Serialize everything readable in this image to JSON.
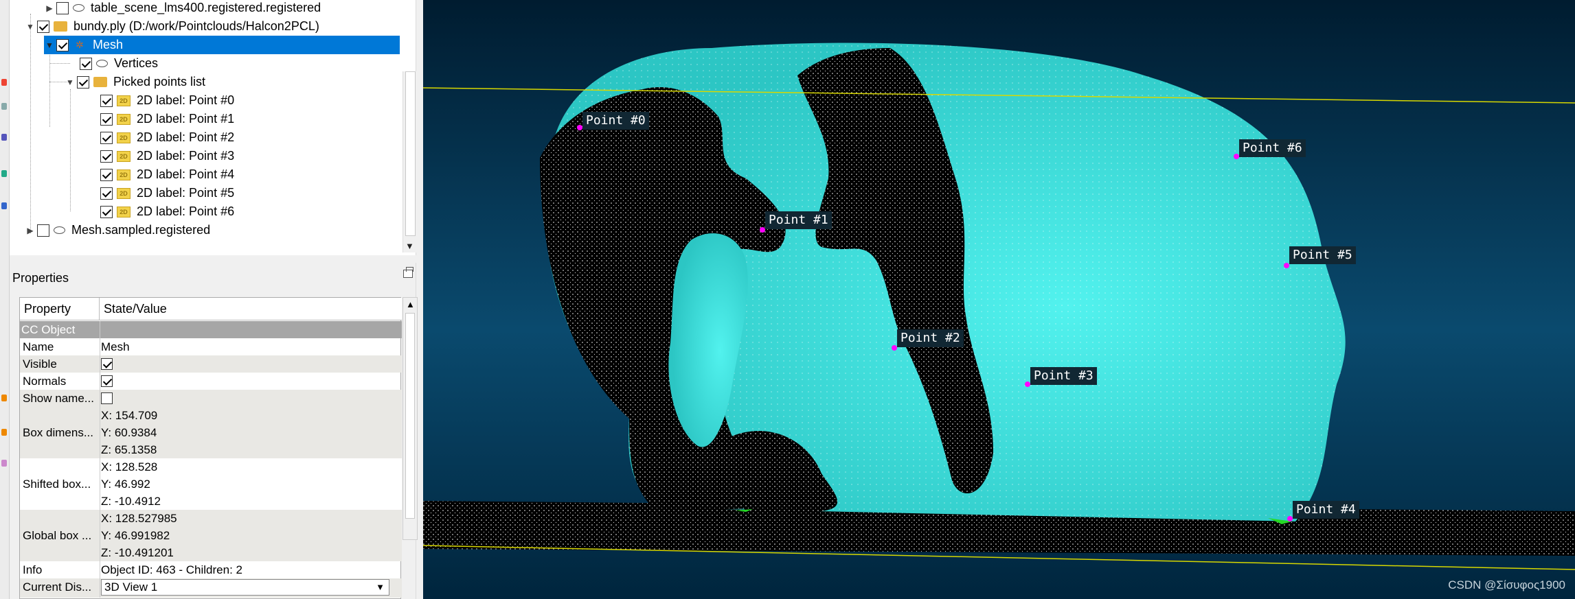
{
  "db_tree": {
    "items": [
      {
        "label": "table_scene_lms400.registered.registered",
        "checked": false,
        "icon": "cloud-icon"
      },
      {
        "label": "bundy.ply (D:/work/Pointclouds/Halcon2PCL)",
        "checked": true,
        "icon": "folder-icon"
      },
      {
        "label": "Mesh",
        "checked": true,
        "icon": "mesh-icon",
        "selected": true
      },
      {
        "label": "Vertices",
        "checked": true,
        "icon": "cloud-icon"
      },
      {
        "label": "Picked points list",
        "checked": true,
        "icon": "folder-icon"
      },
      {
        "label": "2D label: Point #0",
        "checked": true,
        "icon": "label-icon"
      },
      {
        "label": "2D label: Point #1",
        "checked": true,
        "icon": "label-icon"
      },
      {
        "label": "2D label: Point #2",
        "checked": true,
        "icon": "label-icon"
      },
      {
        "label": "2D label: Point #3",
        "checked": true,
        "icon": "label-icon"
      },
      {
        "label": "2D label: Point #4",
        "checked": true,
        "icon": "label-icon"
      },
      {
        "label": "2D label: Point #5",
        "checked": true,
        "icon": "label-icon"
      },
      {
        "label": "2D label: Point #6",
        "checked": true,
        "icon": "label-icon"
      },
      {
        "label": "Mesh.sampled.registered",
        "checked": false,
        "icon": "cloud-icon"
      }
    ]
  },
  "properties": {
    "title": "Properties",
    "col_property": "Property",
    "col_value": "State/Value",
    "section": "CC Object",
    "name_key": "Name",
    "name_val": "Mesh",
    "visible_key": "Visible",
    "visible": true,
    "normals_key": "Normals",
    "normals": true,
    "showname_key": "Show name...",
    "showname": false,
    "box_key": "Box dimens...",
    "box": [
      "X: 154.709",
      "Y: 60.9384",
      "Z: 65.1358"
    ],
    "shifted_key": "Shifted box...",
    "shifted": [
      "X: 128.528",
      "Y: 46.992",
      "Z: -10.4912"
    ],
    "global_key": "Global box ...",
    "global": [
      "X: 128.527985",
      "Y: 46.991982",
      "Z: -10.491201"
    ],
    "info_key": "Info",
    "info_val": "Object ID: 463 - Children: 2",
    "display_key": "Current Dis...",
    "display_val": "3D View 1"
  },
  "viewport": {
    "points": [
      "Point #0",
      "Point #1",
      "Point #2",
      "Point #3",
      "Point #4",
      "Point #5",
      "Point #6"
    ],
    "watermark": "CSDN @Σίσυφος1900",
    "colors": {
      "mesh": "#3fe0dc",
      "holes": "#000000",
      "marker": "#ff00ff",
      "line": "#d8d800"
    }
  }
}
